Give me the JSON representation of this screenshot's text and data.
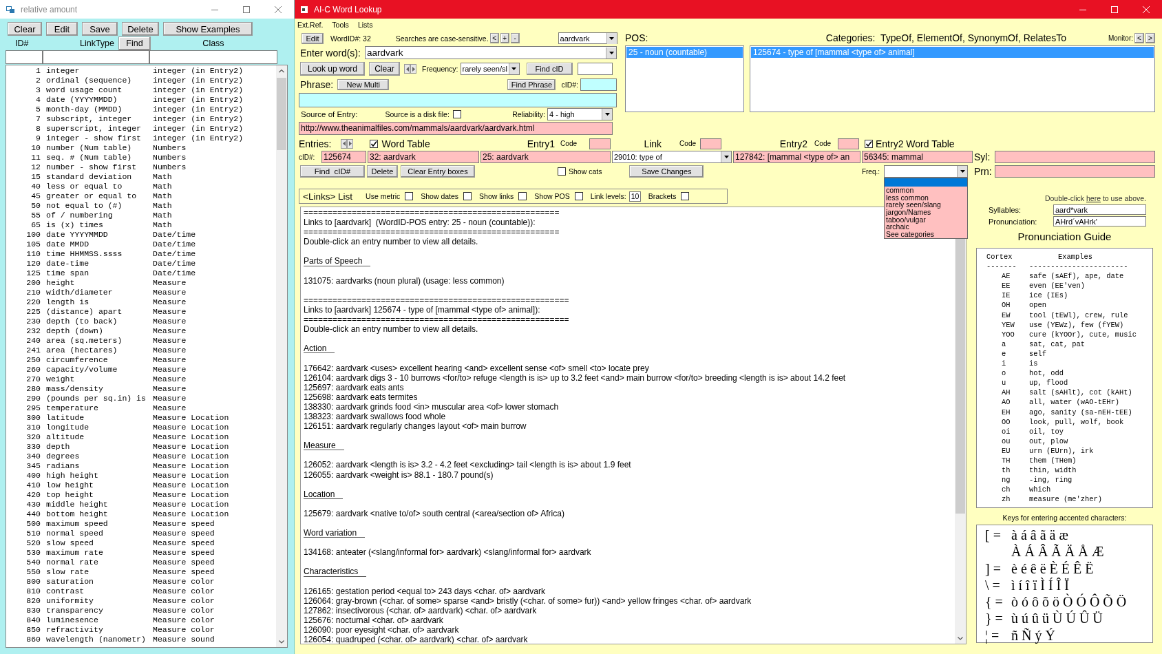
{
  "relative_amount_window": {
    "title": "relative amount",
    "buttons": [
      "Clear",
      "Edit",
      "Save",
      "Delete",
      "Show Examples"
    ],
    "headers": {
      "id": "ID#",
      "link_type": "LinkType",
      "find": "Find",
      "class": "Class"
    },
    "rows": [
      {
        "id": "1",
        "link_type": "integer",
        "class": "integer (in Entry2)"
      },
      {
        "id": "2",
        "link_type": "ordinal (sequence)",
        "class": "integer (in Entry2)"
      },
      {
        "id": "3",
        "link_type": "word usage count",
        "class": "integer (in Entry2)"
      },
      {
        "id": "4",
        "link_type": "date (YYYYMMDD)",
        "class": "integer (in Entry2)"
      },
      {
        "id": "5",
        "link_type": "month-day (MMDD)",
        "class": "integer (in Entry2)"
      },
      {
        "id": "7",
        "link_type": "subscript, integer",
        "class": "integer (in Entry2)"
      },
      {
        "id": "8",
        "link_type": "superscript, integer",
        "class": "integer (in Entry2)"
      },
      {
        "id": "9",
        "link_type": "integer - show first",
        "class": "integer (in Entry2)"
      },
      {
        "id": "10",
        "link_type": "number (Num table)",
        "class": "Numbers"
      },
      {
        "id": "11",
        "link_type": "seq. # (Num table)",
        "class": "Numbers"
      },
      {
        "id": "12",
        "link_type": "number - show first",
        "class": "Numbers"
      },
      {
        "id": "15",
        "link_type": "standard deviation",
        "class": "Math"
      },
      {
        "id": "40",
        "link_type": "less or equal to",
        "class": "Math"
      },
      {
        "id": "45",
        "link_type": "greater or equal to",
        "class": "Math"
      },
      {
        "id": "50",
        "link_type": "not equal to (#)",
        "class": "Math"
      },
      {
        "id": "55",
        "link_type": "of / numbering",
        "class": "Math"
      },
      {
        "id": "65",
        "link_type": "is (x) times",
        "class": "Math"
      },
      {
        "id": "100",
        "link_type": "date YYYYMMDD",
        "class": "Date/time"
      },
      {
        "id": "105",
        "link_type": "date MMDD",
        "class": "Date/time"
      },
      {
        "id": "110",
        "link_type": "time HHMMSS.ssss",
        "class": "Date/time"
      },
      {
        "id": "120",
        "link_type": "date-time",
        "class": "Date/time"
      },
      {
        "id": "125",
        "link_type": "time span",
        "class": "Date/time"
      },
      {
        "id": "200",
        "link_type": "height",
        "class": "Measure"
      },
      {
        "id": "210",
        "link_type": "width/diameter",
        "class": "Measure"
      },
      {
        "id": "220",
        "link_type": "length is",
        "class": "Measure"
      },
      {
        "id": "225",
        "link_type": "(distance) apart",
        "class": "Measure"
      },
      {
        "id": "230",
        "link_type": "depth (to back)",
        "class": "Measure"
      },
      {
        "id": "232",
        "link_type": "depth (down)",
        "class": "Measure"
      },
      {
        "id": "240",
        "link_type": "area (sq.meters)",
        "class": "Measure"
      },
      {
        "id": "241",
        "link_type": "area (hectares)",
        "class": "Measure"
      },
      {
        "id": "250",
        "link_type": "circumference",
        "class": "Measure"
      },
      {
        "id": "260",
        "link_type": "capacity/volume",
        "class": "Measure"
      },
      {
        "id": "270",
        "link_type": "weight",
        "class": "Measure"
      },
      {
        "id": "280",
        "link_type": "mass/density",
        "class": "Measure"
      },
      {
        "id": "290",
        "link_type": "(pounds per sq.in) is",
        "class": "Measure"
      },
      {
        "id": "295",
        "link_type": "temperature",
        "class": "Measure"
      },
      {
        "id": "300",
        "link_type": "latitude",
        "class": "Measure Location"
      },
      {
        "id": "310",
        "link_type": "longitude",
        "class": "Measure Location"
      },
      {
        "id": "320",
        "link_type": "altitude",
        "class": "Measure Location"
      },
      {
        "id": "330",
        "link_type": "depth",
        "class": "Measure Location"
      },
      {
        "id": "340",
        "link_type": "degrees",
        "class": "Measure Location"
      },
      {
        "id": "345",
        "link_type": "radians",
        "class": "Measure Location"
      },
      {
        "id": "400",
        "link_type": "high height",
        "class": "Measure Location"
      },
      {
        "id": "410",
        "link_type": "low height",
        "class": "Measure Location"
      },
      {
        "id": "420",
        "link_type": "top height",
        "class": "Measure Location"
      },
      {
        "id": "430",
        "link_type": "middle height",
        "class": "Measure Location"
      },
      {
        "id": "440",
        "link_type": "bottom height",
        "class": "Measure Location"
      },
      {
        "id": "500",
        "link_type": "maximum speed",
        "class": "Measure speed"
      },
      {
        "id": "510",
        "link_type": "normal speed",
        "class": "Measure speed"
      },
      {
        "id": "520",
        "link_type": "slow speed",
        "class": "Measure speed"
      },
      {
        "id": "530",
        "link_type": "maximum rate",
        "class": "Measure speed"
      },
      {
        "id": "540",
        "link_type": "normal rate",
        "class": "Measure speed"
      },
      {
        "id": "550",
        "link_type": "slow rate",
        "class": "Measure speed"
      },
      {
        "id": "800",
        "link_type": "saturation",
        "class": "Measure color"
      },
      {
        "id": "810",
        "link_type": "contrast",
        "class": "Measure color"
      },
      {
        "id": "820",
        "link_type": "uniformity",
        "class": "Measure color"
      },
      {
        "id": "830",
        "link_type": "transparency",
        "class": "Measure color"
      },
      {
        "id": "840",
        "link_type": "luminesence",
        "class": "Measure color"
      },
      {
        "id": "850",
        "link_type": "refractivity",
        "class": "Measure color"
      },
      {
        "id": "860",
        "link_type": "wavelength (nanometr)",
        "class": "Measure sound"
      }
    ]
  },
  "word_lookup_window": {
    "title": "AI-C Word Lookup",
    "menu": [
      "Ext.Ref.",
      "Tools",
      "Lists"
    ],
    "search": {
      "edit_button": "Edit",
      "word_id": "WordID#: 32",
      "case_note": "Searches are case-sensitive.",
      "nav_buttons": [
        "<",
        "+",
        "-"
      ],
      "word_combo": "aardvark",
      "enter_label": "Enter word(s):",
      "enter_value": "aardvark",
      "lookup_button": "Look up word",
      "clear_button": "Clear",
      "frequency_label": "Frequency:",
      "frequency_value": "rarely seen/sl",
      "find_cid_button": "Find cID",
      "phrase_label": "Phrase:",
      "new_multi_button": "New Multi",
      "find_phrase_button": "Find Phrase",
      "cid_label": "cID#:",
      "source_label": "Source of Entry:",
      "disk_file": {
        "label": "Source is a disk file:",
        "checked": false
      },
      "reliability_label": "Reliability:",
      "reliability_value": "4 - high",
      "source_url": "http://www.theanimalfiles.com/mammals/aardvark/aardvark.html"
    },
    "pos": {
      "label": "POS:",
      "items": [
        {
          "text": "25 - noun (countable)",
          "selected": true
        }
      ]
    },
    "categories": {
      "label": "Categories:  TypeOf, ElementOf, SynonymOf, RelatesTo",
      "items": [
        {
          "text": "125674 - type of [mammal <type of> animal]",
          "selected": true
        }
      ]
    },
    "monitor": {
      "label": "Monitor:",
      "buttons": [
        "<",
        ">"
      ]
    },
    "entries": {
      "label": "Entries:",
      "word_table": {
        "label": "Word Table",
        "checked": true
      },
      "columns": [
        {
          "title": "Entry1",
          "code_label": "Code"
        },
        {
          "title": "Link",
          "code_label": "Code"
        },
        {
          "title": "Entry2",
          "code_label": "Code"
        }
      ],
      "entry2_word_table": {
        "label": "Entry2 Word Table",
        "checked": true
      },
      "cid_label": "cID#:",
      "cid": "125674",
      "entry1_word": "32: aardvark",
      "entry1": "25: aardvark",
      "link": "29010: type of",
      "entry2": "127842: [mammal <type of> an",
      "entry2_word": "56345: mammal",
      "syl_label": "Syl:",
      "find_button": "Find  cID#",
      "delete_button": "Delete",
      "clear_button": "Clear Entry boxes",
      "show_cats": {
        "label": "Show cats",
        "checked": false
      },
      "save_button": "Save Changes",
      "freq_label": "Freq.:",
      "prn_label": "Prn:"
    },
    "freq_dropdown": {
      "options": [
        {
          "kind": "blank",
          "selected": true
        },
        {
          "kind": "option",
          "text": "common",
          "selected": false
        },
        {
          "kind": "option",
          "text": "less common",
          "selected": false
        },
        {
          "kind": "option",
          "text": "rarely seen/slang",
          "selected": false
        },
        {
          "kind": "option",
          "text": "jargon/Names",
          "selected": false
        },
        {
          "kind": "option",
          "text": "taboo/vulgar",
          "selected": false
        },
        {
          "kind": "option",
          "text": "archaic",
          "selected": false
        },
        {
          "kind": "option",
          "text": "See categories",
          "selected": false
        }
      ]
    },
    "links_list": {
      "title": "<Links> List",
      "options": [
        {
          "kind": "checkbox",
          "label": "Use metric",
          "checked": false
        },
        {
          "kind": "checkbox",
          "label": "Show dates",
          "checked": false
        },
        {
          "kind": "checkbox",
          "label": "Show links",
          "checked": false
        },
        {
          "kind": "checkbox",
          "label": "Show POS",
          "checked": false
        },
        {
          "kind": "number",
          "label": "Link levels:",
          "value": "10"
        },
        {
          "kind": "checkbox",
          "label": "Brackets",
          "checked": false
        }
      ],
      "blocks": [
        {
          "kind": "banner",
          "rule_above": "=====================================================",
          "title": "Links to [aardvark]  (WordID-POS entry: 25 - noun (countable)):",
          "rule_below": "=====================================================",
          "note": "Double-click an entry number to view all details."
        },
        {
          "kind": "section",
          "heading": "Parts of Speech",
          "lines": [
            "131075: aardvarks (noun plural) (usage: less common)"
          ]
        },
        {
          "kind": "banner",
          "rule_above": "=======================================================",
          "title": "Links to [aardvark] 125674 - type of [mammal <type of> animal]):",
          "rule_below": "=======================================================",
          "note": "Double-click an entry number to view all details."
        },
        {
          "kind": "section",
          "heading": "Action",
          "lines": [
            "176642: aardvark <uses> excellent hearing <and> excellent sense <of> smell <to> locate prey",
            "126104: aardvark digs 3 - 10 burrows <for/to> refuge <length is is> up to 3.2 feet <and> main burrow <for/to> breeding <length is is> about 14.2 feet",
            "125697: aardvark eats ants",
            "125698: aardvark eats termites",
            "138330: aardvark grinds food <in> muscular area <of> lower stomach",
            "138323: aardvark swallows food whole",
            "126151: aardvark regularly changes layout <of> main burrow"
          ]
        },
        {
          "kind": "section",
          "heading": "Measure",
          "lines": [
            "126052: aardvark <length is is> 3.2 - 4.2 feet <excluding> tail <length is is> about 1.9 feet",
            "126055: aardvark <weight is> 88.1 - 180.7 pound(s)"
          ]
        },
        {
          "kind": "section",
          "heading": "Location",
          "lines": [
            "125679: aardvark <native to/of> south central (<area/section of> Africa)"
          ]
        },
        {
          "kind": "section",
          "heading": "Word variation",
          "lines": [
            "134168: anteater (<slang/informal for> aardvark) <slang/informal for> aardvark"
          ]
        },
        {
          "kind": "section",
          "heading": "Characteristics",
          "lines": [
            "126165: gestation period <equal to> 243 days <char. of> aardvark",
            "126064: gray-brown (<char. of some> sparse <and> bristly (<char. of some> fur)) <and> yellow fringes <char. of> aardvark",
            "127862: insectivorous (<char. of> aardvark) <char. of> aardvark",
            "125676: nocturnal <char. of> aardvark",
            "126090: poor eyesight <char. of> aardvark",
            "126054: quadruped (<char. of> aardvark) <char. of> aardvark"
          ]
        }
      ]
    },
    "pronunciation": {
      "hint": [
        "Double-click",
        "here",
        "to use above."
      ],
      "syllables_label": "Syllables:",
      "syllables": "aard*vark",
      "pronunciation_label": "Pronunciation:",
      "pronunciation": "AHrd´vAHrk'",
      "guide_title": "Pronunciation Guide",
      "guide_headers": [
        "Cortex",
        "Examples"
      ],
      "guide_dashes": [
        "-------",
        "-----------------------"
      ],
      "guide_rows": [
        {
          "cortex": "AE",
          "example": "safe (sAEf), ape, date"
        },
        {
          "cortex": "EE",
          "example": "even (EE'ven)"
        },
        {
          "cortex": "IE",
          "example": "ice (IEs)"
        },
        {
          "cortex": "OH",
          "example": "open"
        },
        {
          "cortex": "EW",
          "example": "tool (tEWl), crew, rule"
        },
        {
          "cortex": "YEW",
          "example": "use (YEWz), few (fYEW)"
        },
        {
          "cortex": "YOO",
          "example": "cure (kYOOr), cute, music"
        },
        {
          "cortex": "a",
          "example": "sat, cat, pat"
        },
        {
          "cortex": "e",
          "example": "self"
        },
        {
          "cortex": "i",
          "example": "is"
        },
        {
          "cortex": "o",
          "example": "hot, odd"
        },
        {
          "cortex": "u",
          "example": "up, flood"
        },
        {
          "cortex": "AH",
          "example": "salt (sAHlt), cot (kAHt)"
        },
        {
          "cortex": "AO",
          "example": "all, water (wAO-tEHr)"
        },
        {
          "cortex": "EH",
          "example": "ago, sanity (sa-nEH-tEE)"
        },
        {
          "cortex": "OO",
          "example": "look, pull, wolf, book"
        },
        {
          "cortex": "oi",
          "example": "oil, toy"
        },
        {
          "cortex": "ou",
          "example": "out, plow"
        },
        {
          "cortex": "EU",
          "example": "urn (EUrn), irk"
        },
        {
          "cortex": "TH",
          "example": "them (THem)"
        },
        {
          "cortex": "th",
          "example": "thin, width"
        },
        {
          "cortex": "ng",
          "example": "-ing, ring"
        },
        {
          "cortex": "ch",
          "example": "which"
        },
        {
          "cortex": "zh",
          "example": "measure (me'zher)"
        }
      ],
      "accent_title": "Keys for entering accented characters:",
      "accent_rows": [
        {
          "key": "[ =",
          "chars": "à á â ã ä æ"
        },
        {
          "chars": "À Á Â Ã Ä Å Æ"
        },
        {
          "key": "] =",
          "chars": "è é ê ë È É Ê Ë"
        },
        {
          "key": "\\ =",
          "chars": "ì í î ï Ì Í Î Ï"
        },
        {
          "key": "{ =",
          "chars": "ò ó ô õ ö Ò Ó Ô Õ Ö"
        },
        {
          "key": "} =",
          "chars": "ù ú û ü Ù Ú Û Ü"
        },
        {
          "key": "¦ =",
          "chars": "ñ Ñ ý Ý"
        }
      ]
    }
  }
}
